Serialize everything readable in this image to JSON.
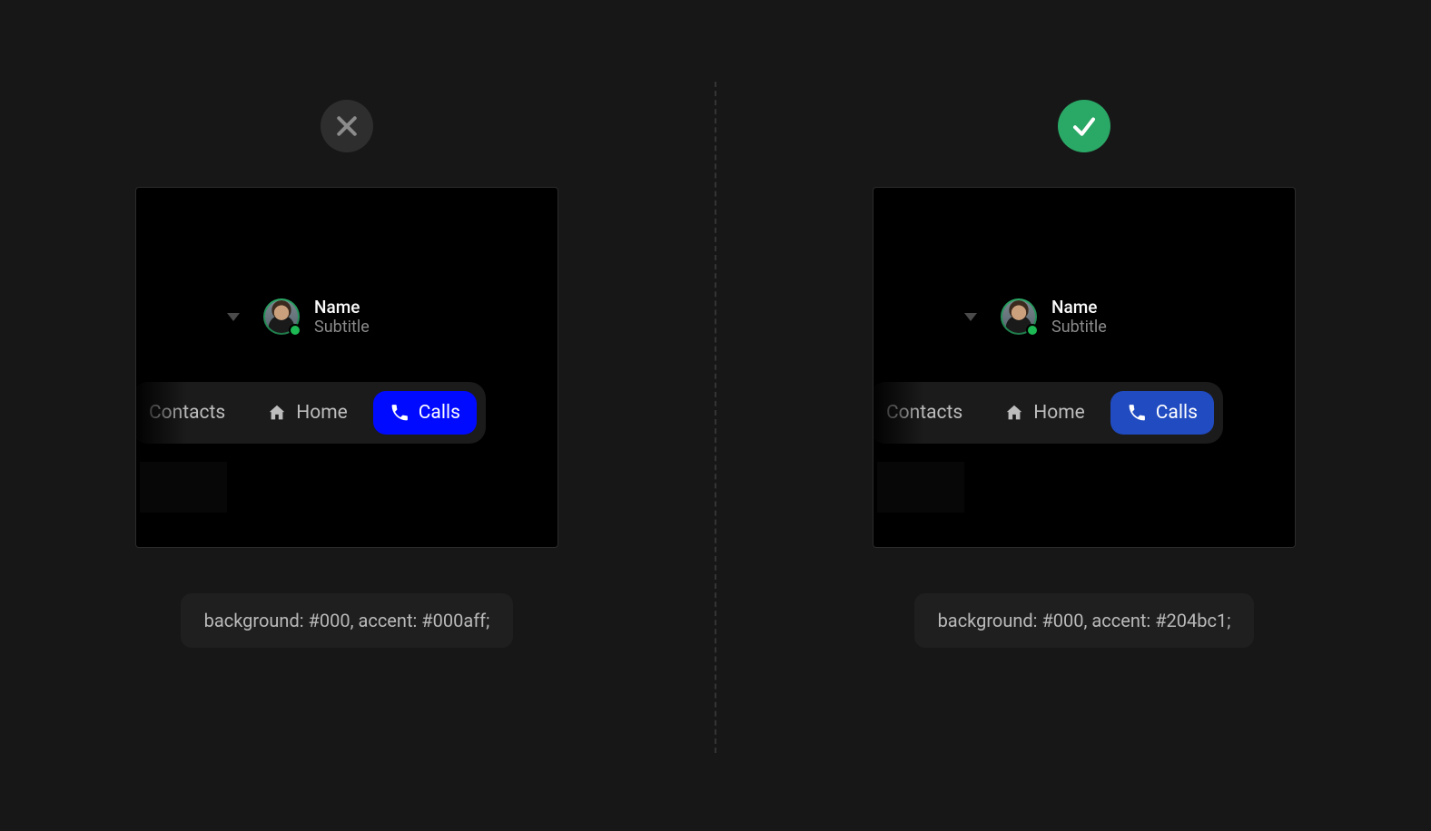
{
  "left": {
    "profile": {
      "name": "Name",
      "subtitle": "Subtitle"
    },
    "tabs": {
      "contacts": "Contacts",
      "home": "Home",
      "calls": "Calls"
    },
    "caption": "background: #000, accent: #000aff;"
  },
  "right": {
    "profile": {
      "name": "Name",
      "subtitle": "Subtitle"
    },
    "tabs": {
      "contacts": "Contacts",
      "home": "Home",
      "calls": "Calls"
    },
    "caption": "background: #000, accent: #204bc1;"
  }
}
